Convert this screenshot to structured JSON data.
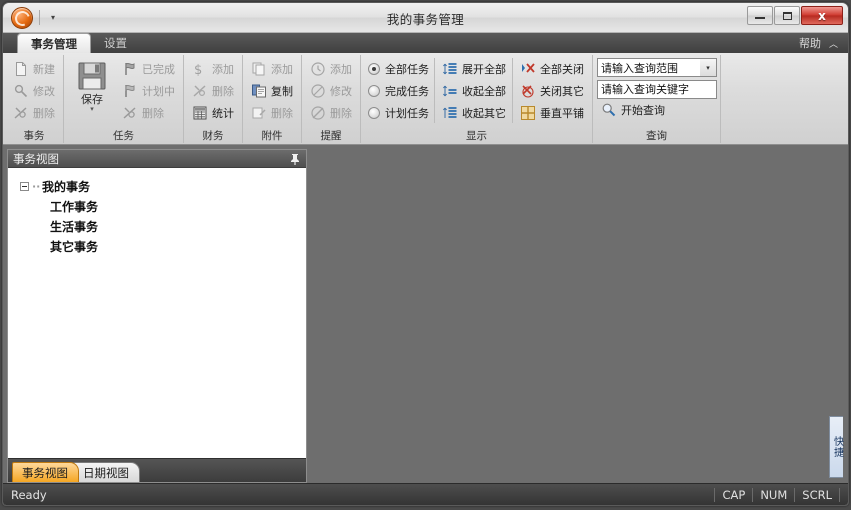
{
  "window": {
    "title": "我的事务管理",
    "minimize_label": "最小化",
    "maximize_label": "最大化",
    "close_label": "x"
  },
  "quick_access": {
    "orb_label": "app-orb",
    "customize_label": "▾"
  },
  "ribbon": {
    "tabs": [
      {
        "label": "事务管理",
        "active": true
      },
      {
        "label": "设置",
        "active": false
      }
    ],
    "help_label": "帮助",
    "collapse_label": "︿",
    "groups": [
      {
        "name": "事务",
        "items": [
          {
            "label": "新建",
            "enabled": false,
            "icon": "new-document-icon"
          },
          {
            "label": "修改",
            "enabled": false,
            "icon": "edit-icon"
          },
          {
            "label": "删除",
            "enabled": false,
            "icon": "delete-icon"
          }
        ]
      },
      {
        "name": "任务",
        "big": {
          "label": "保存",
          "icon": "save-icon",
          "chev": "▾",
          "enabled": true
        },
        "items": [
          {
            "label": "已完成",
            "enabled": false,
            "icon": "flag-done-icon"
          },
          {
            "label": "计划中",
            "enabled": false,
            "icon": "flag-plan-icon"
          },
          {
            "label": "删除",
            "enabled": false,
            "icon": "delete-icon"
          }
        ]
      },
      {
        "name": "财务",
        "items": [
          {
            "label": "添加",
            "enabled": false,
            "icon": "money-add-icon"
          },
          {
            "label": "删除",
            "enabled": false,
            "icon": "money-delete-icon"
          },
          {
            "label": "统计",
            "enabled": true,
            "icon": "calculator-icon"
          }
        ]
      },
      {
        "name": "附件",
        "items": [
          {
            "label": "添加",
            "enabled": false,
            "icon": "attach-add-icon"
          },
          {
            "label": "复制",
            "enabled": true,
            "icon": "copy-icon"
          },
          {
            "label": "删除",
            "enabled": false,
            "icon": "attach-delete-icon"
          }
        ]
      },
      {
        "name": "提醒",
        "items": [
          {
            "label": "添加",
            "enabled": false,
            "icon": "clock-add-icon"
          },
          {
            "label": "修改",
            "enabled": false,
            "icon": "clock-edit-icon"
          },
          {
            "label": "删除",
            "enabled": false,
            "icon": "clock-delete-icon"
          }
        ]
      }
    ],
    "display_group": {
      "name": "显示",
      "radios": [
        {
          "label": "全部任务",
          "selected": true
        },
        {
          "label": "完成任务",
          "selected": false
        },
        {
          "label": "计划任务",
          "selected": false
        }
      ],
      "tree_commands": [
        {
          "label": "展开全部",
          "icon": "expand-all-icon"
        },
        {
          "label": "收起全部",
          "icon": "collapse-all-icon"
        },
        {
          "label": "收起其它",
          "icon": "collapse-others-icon"
        }
      ],
      "window_commands": [
        {
          "label": "全部关闭",
          "icon": "close-all-icon"
        },
        {
          "label": "关闭其它",
          "icon": "close-others-icon"
        },
        {
          "label": "垂直平铺",
          "icon": "tile-vertical-icon"
        }
      ]
    },
    "query_group": {
      "name": "查询",
      "scope_value": "请输入查询范围",
      "scope_arrow": "▾",
      "keyword_value": "请输入查询关键字",
      "search_button": "开始查询",
      "search_icon": "search-icon"
    }
  },
  "dock_panel": {
    "title": "事务视图",
    "pin_icon": "pin-icon",
    "tree": {
      "root": {
        "label": "我的事务",
        "expander": "−"
      },
      "children": [
        {
          "label": "工作事务"
        },
        {
          "label": "生活事务"
        },
        {
          "label": "其它事务"
        }
      ]
    },
    "tabs": [
      {
        "label": "事务视图",
        "active": true
      },
      {
        "label": "日期视图",
        "active": false
      }
    ]
  },
  "side_panel": {
    "label": "快捷"
  },
  "status_bar": {
    "message": "Ready",
    "indicators": [
      "CAP",
      "NUM",
      "SCRL"
    ]
  },
  "colors": {
    "accent": "#f5a623",
    "close_button": "#cf3a30",
    "mdi_background": "#6e6e6e",
    "orb": "#e4690f"
  }
}
